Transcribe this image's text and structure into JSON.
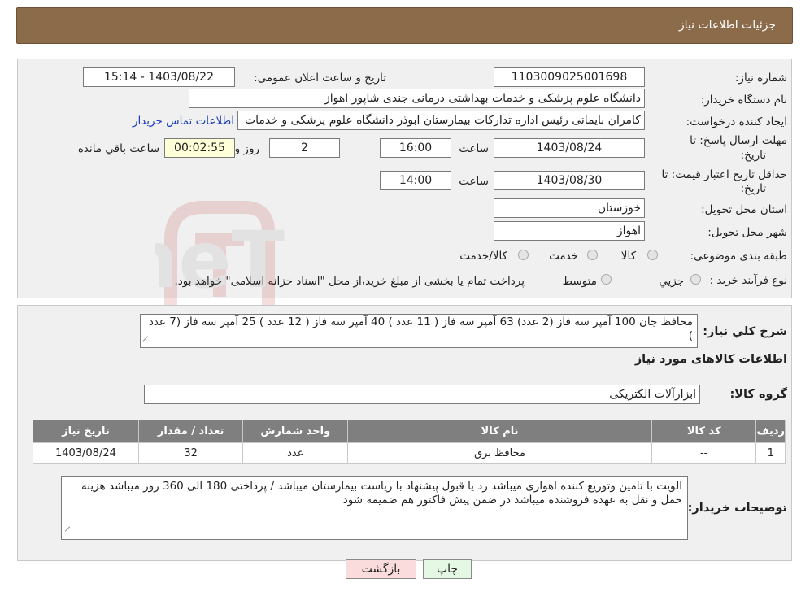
{
  "header": {
    "title": "جزئیات اطلاعات نیاز"
  },
  "form": {
    "need_number_label": "شماره نیاز:",
    "need_number": "1103009025001698",
    "announce_label": "تاریخ و ساعت اعلان عمومی:",
    "announce_value": "1403/08/22 - 15:14",
    "buyer_org_label": "نام دستگاه خریدار:",
    "buyer_org": "دانشگاه علوم پزشکی و خدمات بهداشتی درمانی جندی شاپور اهواز",
    "requester_label": "ایجاد کننده درخواست:",
    "requester": "کامران بایمانی رئیس اداره تدارکات بیمارستان ابوذر  دانشگاه علوم پزشکی و خدمات",
    "contact_link": "اطلاعات تماس خریدار",
    "deadline_label_1": "مهلت ارسال پاسخ: تا",
    "deadline_label_2": "تاریخ:",
    "deadline_date": "1403/08/24",
    "time_label": "ساعت",
    "deadline_time": "16:00",
    "days_value": "2",
    "days_label": "روز و",
    "remaining_value": "00:02:55",
    "remaining_label": "ساعت باقي مانده",
    "validity_label_1": "حداقل تاریخ اعتبار قیمت: تا",
    "validity_label_2": "تاریخ:",
    "validity_date": "1403/08/30",
    "validity_time_label": "ساعت",
    "validity_time": "14:00",
    "province_label": "استان محل تحویل:",
    "province": "خوزستان",
    "city_label": "شهر محل تحویل:",
    "city": "اهواز",
    "category_label": "طبقه بندی موضوعی:",
    "category_options": [
      "کالا",
      "خدمت",
      "کالا/خدمت"
    ],
    "process_label": "نوع فرآیند خرید :",
    "process_options": [
      "جزیي",
      "متوسط"
    ],
    "process_note": "پرداخت تمام یا بخشی از مبلغ خرید،از محل \"اسناد خزانه اسلامی\" خواهد بود."
  },
  "description": {
    "label": "شرح كلي نياز:",
    "text": "محافظ جان 100 آمپر سه فاز (2 عدد)  63 آمپر سه فاز  ( 11 عدد ) 40 آمپر سه فاز ( 12 عدد ) 25 آمپر سه فاز (7 عدد )"
  },
  "goods": {
    "section_title": "اطلاعات كالاهای مورد نیاز",
    "group_label": "گروه کالا:",
    "group_value": "ابزارآلات الكتريكی",
    "columns": [
      "ردیف",
      "کد کالا",
      "نام کالا",
      "واحد شمارش",
      "تعداد / مقدار",
      "تاریخ نیاز"
    ],
    "rows": [
      [
        "1",
        "--",
        "محافظ برق",
        "عدد",
        "32",
        "1403/08/24"
      ]
    ]
  },
  "buyer_notes": {
    "label": "توضیحات خریدار:",
    "text": "الویت با تامین وتوزیع کننده اهوازی  میباشد رد یا قبول پیشنهاد با ریاست بیمارستان میباشد / پرداختی 180 الی 360 روز میباشد  هزینه حمل و نقل به عهده فروشنده میباشد  در ضمن پیش فاکتور هم ضمیمه شود"
  },
  "buttons": {
    "print": "چاپ",
    "back": "بازگشت"
  },
  "watermark_text": "AriaTender.neT",
  "colors": {
    "header_bg": "#8b6b4a",
    "table_header_bg": "#7f7f7f",
    "back_button_bg": "#fbdcdc",
    "print_button_bg": "#e4f8e4",
    "link": "#1a3db8"
  }
}
